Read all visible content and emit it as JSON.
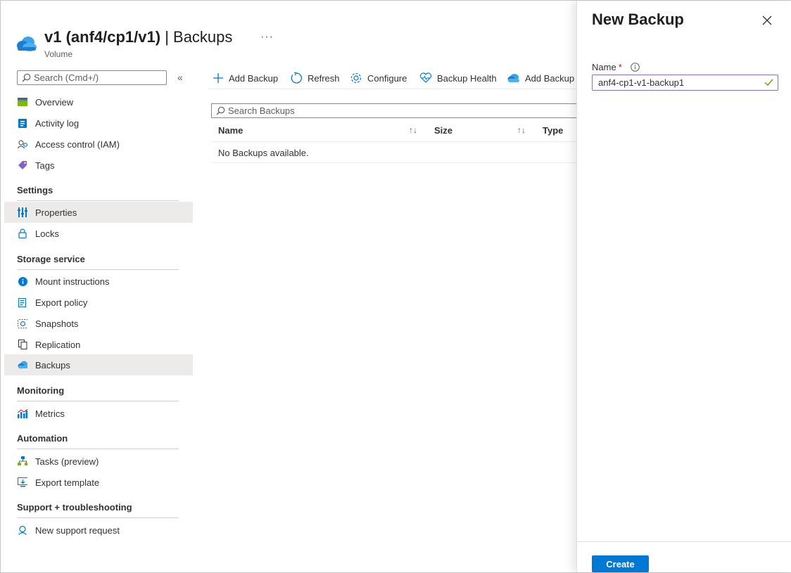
{
  "header": {
    "title": "v1 (anf4/cp1/v1)",
    "title_suffix": " | Backups",
    "subtitle": "Volume",
    "more": "···"
  },
  "sidebar": {
    "search_placeholder": "Search (Cmd+/)",
    "collapse": "«",
    "items_top": [
      {
        "label": "Overview",
        "icon": "overview-icon"
      },
      {
        "label": "Activity log",
        "icon": "activity-log-icon"
      },
      {
        "label": "Access control (IAM)",
        "icon": "iam-icon"
      },
      {
        "label": "Tags",
        "icon": "tag-icon"
      }
    ],
    "sections": [
      {
        "title": "Settings",
        "items": [
          {
            "label": "Properties",
            "icon": "properties-icon",
            "selected": true
          },
          {
            "label": "Locks",
            "icon": "lock-icon"
          }
        ]
      },
      {
        "title": "Storage service",
        "items": [
          {
            "label": "Mount instructions",
            "icon": "info-icon"
          },
          {
            "label": "Export policy",
            "icon": "export-policy-icon"
          },
          {
            "label": "Snapshots",
            "icon": "snapshot-icon"
          },
          {
            "label": "Replication",
            "icon": "replication-icon"
          },
          {
            "label": "Backups",
            "icon": "backup-cloud-icon",
            "selected": true
          }
        ]
      },
      {
        "title": "Monitoring",
        "items": [
          {
            "label": "Metrics",
            "icon": "metrics-icon"
          }
        ]
      },
      {
        "title": "Automation",
        "items": [
          {
            "label": "Tasks (preview)",
            "icon": "tasks-icon"
          },
          {
            "label": "Export template",
            "icon": "export-template-icon"
          }
        ]
      },
      {
        "title": "Support + troubleshooting",
        "items": [
          {
            "label": "New support request",
            "icon": "support-icon"
          }
        ]
      }
    ]
  },
  "toolbar": {
    "add_backup": "Add Backup",
    "refresh": "Refresh",
    "configure": "Configure",
    "backup_health": "Backup Health",
    "add_backup_2": "Add Backup"
  },
  "table": {
    "search_placeholder": "Search Backups",
    "columns": [
      "Name",
      "Size",
      "Type"
    ],
    "empty_message": "No Backups available."
  },
  "panel": {
    "title": "New Backup",
    "name_label": "Name",
    "required_mark": "*",
    "name_value": "anf4-cp1-v1-backup1",
    "create_label": "Create"
  },
  "colors": {
    "accent": "#0078d4",
    "input_focus": "#8c6dc4",
    "valid_check": "#57a300",
    "required": "#a4262c",
    "selected_bg": "#edebe9"
  }
}
